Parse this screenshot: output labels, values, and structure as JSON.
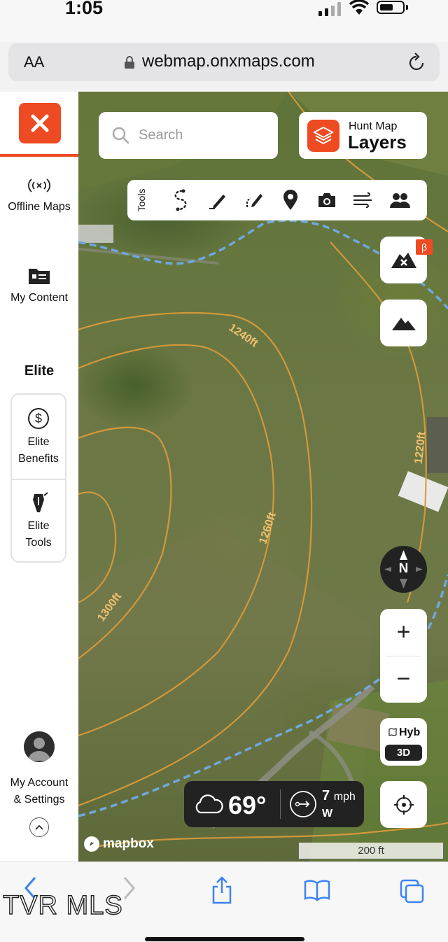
{
  "status_bar": {
    "time": "1:05"
  },
  "browser": {
    "text_size_label": "AA",
    "url": "webmap.onxmaps.com"
  },
  "sidebar": {
    "offline_maps": "Offline Maps",
    "my_content": "My Content",
    "elite_heading": "Elite",
    "elite_benefits": [
      "Elite",
      "Benefits"
    ],
    "elite_tools": [
      "Elite",
      "Tools"
    ],
    "account": [
      "My Account",
      "& Settings"
    ]
  },
  "search": {
    "placeholder": "Search"
  },
  "layers": {
    "small": "Hunt Map",
    "big": "Layers"
  },
  "toolbar": {
    "label": "Tools"
  },
  "beta_badge": "β",
  "compass": {
    "label": "N"
  },
  "zoom": {
    "in": "+",
    "out": "−"
  },
  "basemap": {
    "label": "Hyb",
    "mode": "3D"
  },
  "weather": {
    "temperature": "69°",
    "wind_speed": "7",
    "wind_unit": "mph",
    "wind_direction": "W"
  },
  "contours": [
    "1240ft",
    "1260ft",
    "1300ft",
    "1220ft"
  ],
  "attribution": "mapbox",
  "scale": "200 ft",
  "watermark": "TVR MLS",
  "colors": {
    "accent": "#ee4b23",
    "contour": "#d89a3a",
    "water": "#6fa8dc"
  }
}
